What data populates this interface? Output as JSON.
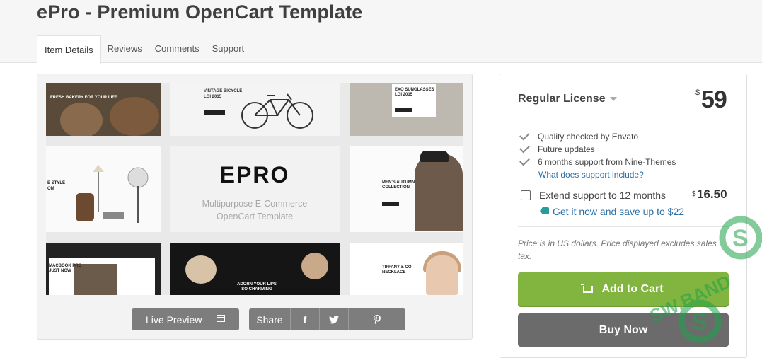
{
  "page": {
    "title": "ePro - Premium OpenCart Template"
  },
  "tabs": [
    {
      "label": "Item Details",
      "active": true
    },
    {
      "label": "Reviews",
      "active": false
    },
    {
      "label": "Comments",
      "active": false
    },
    {
      "label": "Support",
      "active": false
    }
  ],
  "preview": {
    "logo": "EPRO",
    "subtitle_line1": "Multipurpose E-Commerce",
    "subtitle_line2": "OpenCart Template",
    "tiles": {
      "bakery": "FRESH BAKERY FOR YOUR LIFE",
      "bicycle_line1": "VINTAGE BICYCLE",
      "bicycle_line2": "LGI 2015",
      "sunglasses_line1": "EXO SUNGLASSES",
      "sunglasses_line2": "LGI 2015",
      "style_line1": "E STYLE",
      "style_line2": "OM",
      "autumn_line1": "MEN'S AUTUMN",
      "autumn_line2": "COLLECTION",
      "macbook_line1": "MACBOOK PRO",
      "macbook_line2": "JUST NOW",
      "lips_line1": "ADORN YOUR LIPS",
      "lips_line2": "SO CHARMING",
      "necklace_line1": "TIFFANY & CO",
      "necklace_line2": "NECKLACE"
    },
    "live_preview_label": "Live Preview",
    "share_label": "Share",
    "social_icons": [
      "facebook-icon",
      "twitter-icon",
      "pinterest-icon"
    ],
    "social_glyphs": [
      "f",
      "❧",
      "℘"
    ]
  },
  "license": {
    "title": "Regular License",
    "currency_symbol": "$",
    "price": "59",
    "features": [
      "Quality checked by Envato",
      "Future updates",
      "6 months support from Nine-Themes"
    ],
    "support_link": "What does support include?",
    "extend_label": "Extend support to 12 months",
    "extend_currency": "$",
    "extend_price": "16.50",
    "save_link": "Get it now and save up to $22",
    "price_note": "Price is in US dollars. Price displayed excludes sales tax.",
    "add_to_cart": "Add to Cart",
    "buy_now": "Buy Now"
  },
  "watermark": {
    "text": "SW.BAND"
  },
  "colors": {
    "accent_green": "#82b440",
    "link_blue": "#2a6fa8",
    "button_gray": "#7d7d7d",
    "watermark_green": "#1ea24a"
  }
}
